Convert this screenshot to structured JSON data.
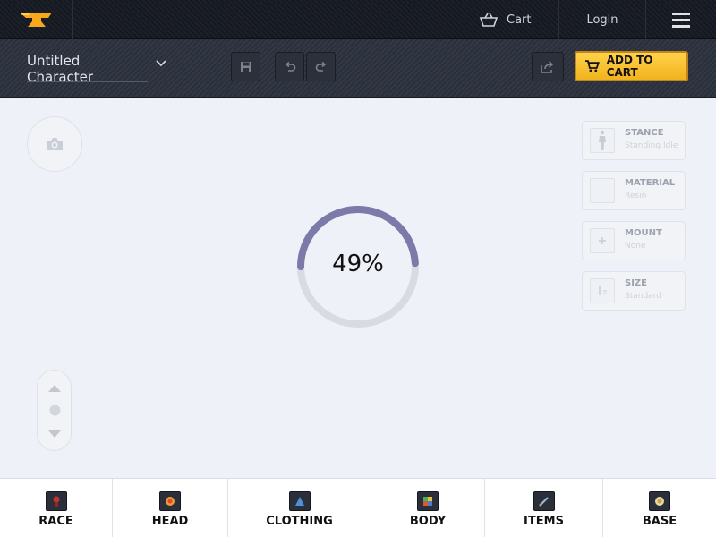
{
  "header": {
    "logo": "anvil-logo",
    "cart_label": "Cart",
    "login_label": "Login",
    "menu_icon": "hamburger-icon"
  },
  "toolbar": {
    "character_name": "Untitled Character",
    "add_to_cart_label": "ADD TO CART",
    "icons": [
      "save-icon",
      "undo-icon",
      "redo-icon",
      "share-icon",
      "cart-icon"
    ]
  },
  "loading": {
    "progress_label": "49%",
    "progress_value": 0.49
  },
  "options": [
    {
      "title": "STANCE",
      "value": "Standing Idle",
      "icon": "figure-icon"
    },
    {
      "title": "MATERIAL",
      "value": "Resin",
      "icon": "material-swatch-icon"
    },
    {
      "title": "MOUNT",
      "value": "None",
      "icon": "plus-icon"
    },
    {
      "title": "SIZE",
      "value": "Standard",
      "icon": "size-icon"
    }
  ],
  "bottom_nav": [
    {
      "label": "RACE",
      "icon": "race-icon"
    },
    {
      "label": "HEAD",
      "icon": "head-icon"
    },
    {
      "label": "CLOTHING",
      "icon": "clothing-icon"
    },
    {
      "label": "BODY",
      "icon": "body-icon"
    },
    {
      "label": "ITEMS",
      "icon": "items-icon"
    },
    {
      "label": "BASE",
      "icon": "base-icon"
    }
  ],
  "colors": {
    "accent": "#f5b928",
    "progress_track": "#d9dbe3",
    "progress_fill": "#7b7aa8",
    "header_bg": "#181b22"
  }
}
